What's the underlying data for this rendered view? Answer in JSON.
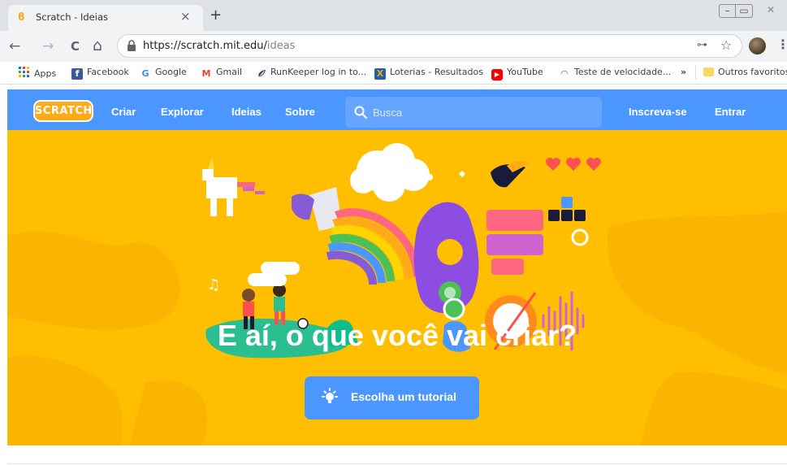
{
  "browser": {
    "tab": {
      "title": "Scratch - Ideias",
      "close": "×"
    },
    "new_tab": "+",
    "window_controls": {
      "minimize": "–",
      "maximize": "▭",
      "close": "✕"
    },
    "nav": {
      "back": "←",
      "forward": "→",
      "reload": "C",
      "home": "⌂"
    },
    "address": {
      "host": "https://scratch.mit.edu/",
      "path": "ideas"
    },
    "key": "⊶",
    "star": "☆",
    "menu": "⋮"
  },
  "bookmarks": {
    "apps": "Apps",
    "items": [
      {
        "label": "Facebook",
        "icon": "facebook-icon"
      },
      {
        "label": "Google",
        "icon": "google-icon"
      },
      {
        "label": "Gmail",
        "icon": "gmail-icon"
      },
      {
        "label": "RunKeeper log in to...",
        "icon": "runkeeper-icon"
      },
      {
        "label": "Loterias - Resultados",
        "icon": "loterias-icon"
      },
      {
        "label": "YouTube",
        "icon": "youtube-icon"
      },
      {
        "label": "Teste de velocidade...",
        "icon": "speedtest-icon"
      }
    ],
    "overflow": "»",
    "other": "Outros favoritos"
  },
  "scratch": {
    "logo": "SCRATCH",
    "nav": {
      "create": "Criar",
      "explore": "Explorar",
      "ideas": "Ideias",
      "about": "Sobre",
      "search_placeholder": "Busca",
      "join": "Inscreva-se",
      "signin": "Entrar"
    },
    "hero": {
      "title": "E aí, o que você vai criar?",
      "button": "Escolha um tutorial"
    },
    "colors": {
      "nav_blue": "#4c97ff",
      "hero_yellow": "#ffbf00",
      "logo_orange": "#ffab19"
    }
  }
}
